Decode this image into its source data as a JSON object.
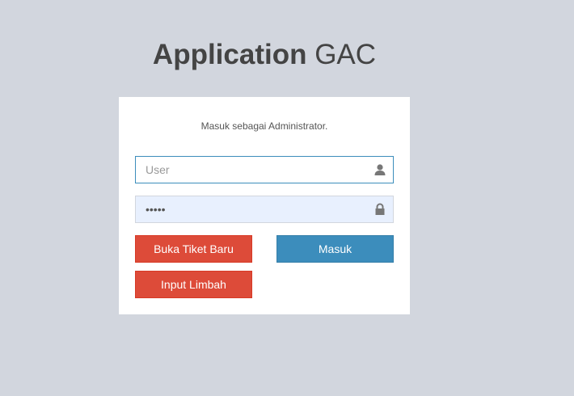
{
  "logo": {
    "bold": "Application",
    "light": " GAC"
  },
  "login": {
    "message": "Masuk sebagai Administrator.",
    "user": {
      "placeholder": "User",
      "value": "",
      "icon": "user-icon"
    },
    "password": {
      "value": "•••••",
      "icon": "lock-icon"
    },
    "buttons": {
      "ticket": "Buka Tiket Baru",
      "submit": "Masuk",
      "waste": "Input Limbah"
    }
  },
  "colors": {
    "background": "#d2d6de",
    "danger": "#dd4b39",
    "primary": "#3c8dbc"
  }
}
